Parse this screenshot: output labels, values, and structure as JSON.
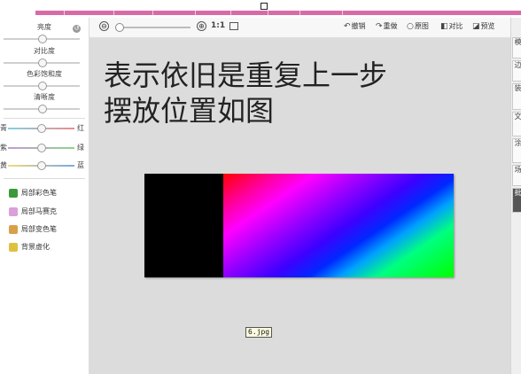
{
  "left_panel": {
    "adjustments": [
      {
        "label": "亮度",
        "value": 0.5
      },
      {
        "label": "对比度",
        "value": 0.5
      },
      {
        "label": "色彩饱和度",
        "value": 0.5
      },
      {
        "label": "清晰度",
        "value": 0.5
      }
    ],
    "color_sliders": [
      {
        "left": "青",
        "right": "红",
        "value": 0.5,
        "colors": [
          "#7fd3e8",
          "#f08a8a"
        ]
      },
      {
        "left": "紫",
        "right": "绿",
        "value": 0.5,
        "colors": [
          "#c89ad6",
          "#8ad68a"
        ]
      },
      {
        "left": "黄",
        "right": "蓝",
        "value": 0.5,
        "colors": [
          "#f0dc7a",
          "#7aa8e8"
        ]
      }
    ],
    "tools": [
      {
        "label": "局部彩色笔",
        "icon": "color-pen-icon",
        "color": "#3a9a3a"
      },
      {
        "label": "局部马赛克",
        "icon": "mosaic-icon",
        "color": "#d9a0d9"
      },
      {
        "label": "局部变色笔",
        "icon": "change-color-pen-icon",
        "color": "#d9a04a"
      },
      {
        "label": "背景虚化",
        "icon": "blur-background-icon",
        "color": "#e0c040"
      }
    ]
  },
  "toolbar": {
    "zoom_out_icon": "⊖",
    "zoom_in_icon": "⊕",
    "zoom_value": 0.05,
    "actual_size_label": "1:1",
    "buttons": [
      {
        "label": "撤销",
        "icon": "undo-icon",
        "glyph": "↶"
      },
      {
        "label": "重做",
        "icon": "redo-icon",
        "glyph": "↷"
      },
      {
        "label": "原图",
        "icon": "original-icon",
        "glyph": "○"
      },
      {
        "label": "对比",
        "icon": "compare-icon",
        "glyph": "◧"
      },
      {
        "label": "预览",
        "icon": "preview-icon",
        "glyph": "◪"
      }
    ]
  },
  "canvas": {
    "text_lines": [
      "表示依旧是重复上一步",
      "摆放位置如图"
    ],
    "image_filename": "6.jpg"
  },
  "right_tabs": [
    "模",
    "边",
    "装",
    "文",
    "涂",
    "场",
    "批"
  ],
  "colors": {
    "top_bar": "#d86aa8",
    "canvas_bg": "#dcdcdc"
  }
}
